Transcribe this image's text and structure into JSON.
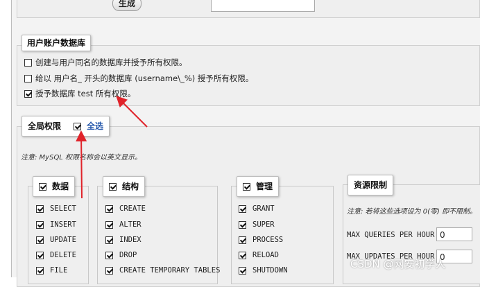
{
  "top": {
    "generate_label": "生成",
    "password_input_value": ""
  },
  "user_db": {
    "legend": "用户账户数据库",
    "options": [
      {
        "label": "创建与用户同名的数据库并授予所有权限。",
        "checked": false
      },
      {
        "label": "给以 用户名_ 开头的数据库 (username\\_%) 授予所有权限。",
        "checked": false
      },
      {
        "label": "授予数据库 test 所有权限。",
        "checked": true
      }
    ]
  },
  "global": {
    "legend": "全局权限",
    "select_all": "全选",
    "note": "注意: MySQL 权限名称会以英文显示。"
  },
  "groups": {
    "data": {
      "label": "数据",
      "items": [
        "SELECT",
        "INSERT",
        "UPDATE",
        "DELETE",
        "FILE"
      ]
    },
    "structure": {
      "label": "结构",
      "items": [
        "CREATE",
        "ALTER",
        "INDEX",
        "DROP",
        "CREATE TEMPORARY TABLES"
      ]
    },
    "admin": {
      "label": "管理",
      "items": [
        "GRANT",
        "SUPER",
        "PROCESS",
        "RELOAD",
        "SHUTDOWN"
      ]
    }
  },
  "resources": {
    "legend": "资源限制",
    "note": "注意: 若将这些选项设为 0(零) 即不限制。",
    "limits": [
      {
        "label": "MAX QUERIES PER HOUR",
        "value": "0"
      },
      {
        "label": "MAX UPDATES PER HOUR",
        "value": "0"
      }
    ]
  },
  "watermark": "CSDN @网安初学人",
  "colors": {
    "arrow": "#e0232a",
    "link": "#2255aa",
    "panel": "#efefef"
  }
}
